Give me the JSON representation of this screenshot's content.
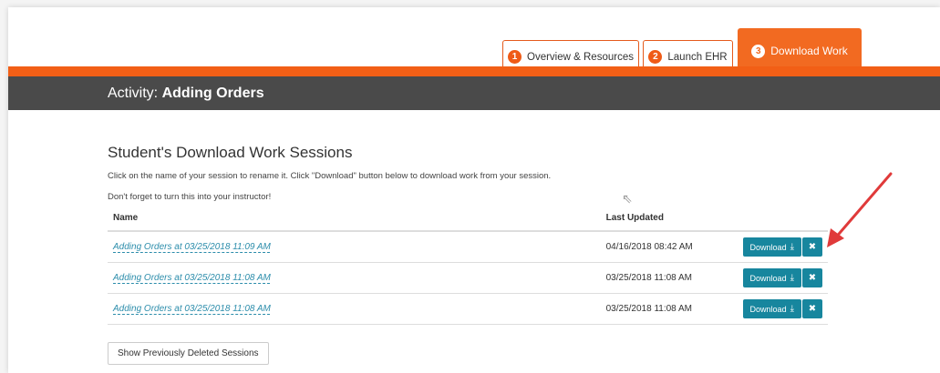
{
  "tabs": [
    {
      "num": "1",
      "label": "Overview & Resources"
    },
    {
      "num": "2",
      "label": "Launch EHR"
    },
    {
      "num": "3",
      "label": "Download Work"
    }
  ],
  "header": {
    "prefix": "Activity:",
    "title": "Adding Orders"
  },
  "section": {
    "title": "Student's Download Work Sessions",
    "desc1": "Click on the name of your session to rename it. Click \"Download\" button below to download work from your session.",
    "desc2": "Don't forget to turn this into your instructor!"
  },
  "table": {
    "col_name": "Name",
    "col_updated": "Last Updated",
    "rows": [
      {
        "name": "Adding Orders at 03/25/2018 11:09 AM",
        "updated": "04/16/2018 08:42 AM"
      },
      {
        "name": "Adding Orders at 03/25/2018 11:08 AM",
        "updated": "03/25/2018 11:08 AM"
      },
      {
        "name": "Adding Orders at 03/25/2018 11:08 AM",
        "updated": "03/25/2018 11:08 AM"
      }
    ]
  },
  "buttons": {
    "download": "Download",
    "download_icon": "download-icon",
    "delete_icon": "close-icon",
    "show_deleted": "Show Previously Deleted Sessions"
  },
  "colors": {
    "accent": "#f26a21",
    "teal": "#17869e",
    "dark": "#4a4a4a",
    "annotation": "#e03a3a"
  }
}
